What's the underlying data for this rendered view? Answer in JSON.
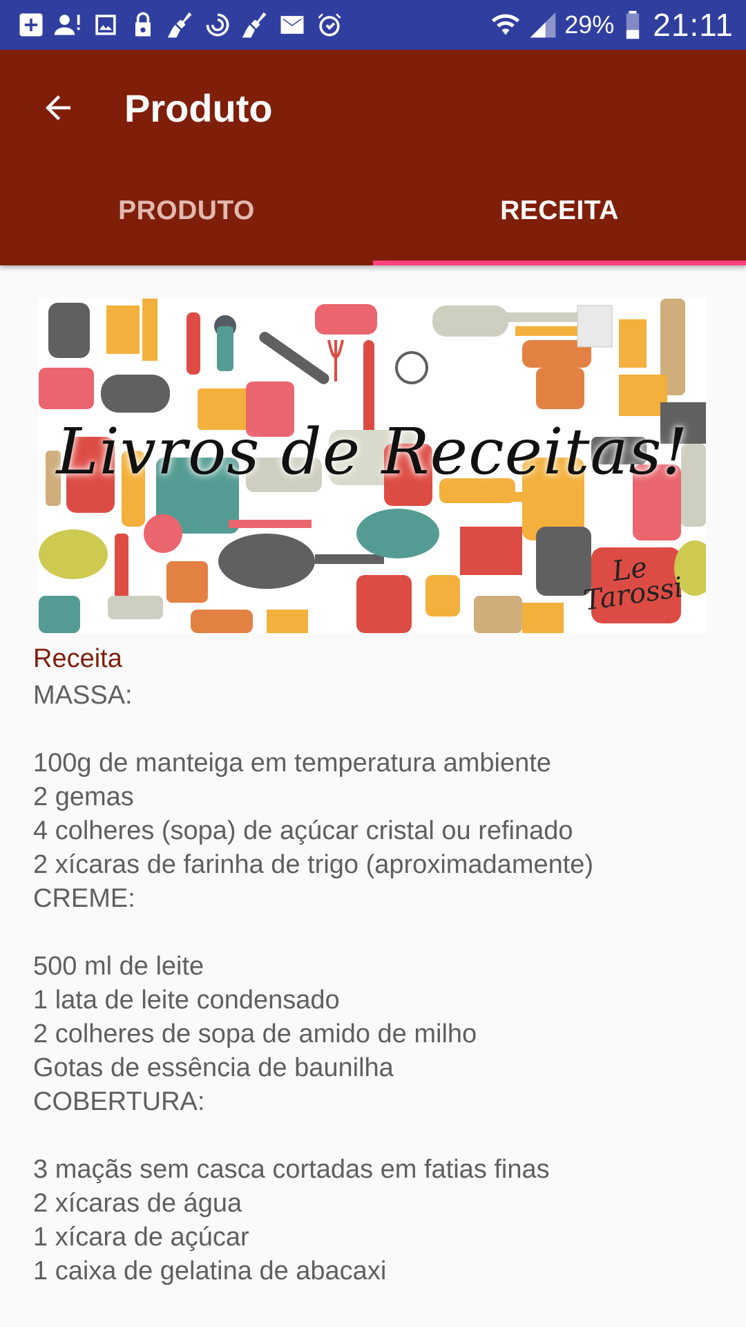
{
  "status_bar": {
    "icons": [
      "add-box-icon",
      "person-alert-icon",
      "image-icon",
      "lock-icon",
      "broom-icon",
      "sync-icon",
      "broom-icon",
      "mail-icon",
      "alarm-icon",
      "wifi-icon",
      "signal-icon",
      "battery-icon"
    ],
    "battery_percent": "29%",
    "time": "21:11",
    "color": "#303F9F"
  },
  "app_bar": {
    "title": "Produto",
    "back_icon": "arrow-back-icon",
    "color": "#7F1F0A"
  },
  "tabs": [
    {
      "label": "PRODUTO",
      "selected": false
    },
    {
      "label": "RECEITA",
      "selected": true
    }
  ],
  "tab_indicator_color": "#FF4081",
  "banner": {
    "title": "Livros de Receitas!",
    "signature_line1": "Le",
    "signature_line2": "Tarossi"
  },
  "recipe": {
    "label": "Receita",
    "lines": [
      "MASSA:",
      "",
      "100g de manteiga em temperatura ambiente",
      "2 gemas",
      "4 colheres (sopa) de açúcar cristal ou refinado",
      "2 xícaras de farinha de trigo (aproximadamente)",
      "CREME:",
      "",
      "500 ml de leite",
      "1 lata de leite condensado",
      "2 colheres de sopa de amido de milho",
      "Gotas de essência de baunilha",
      "COBERTURA:",
      "",
      "3 maçãs sem casca cortadas em fatias finas",
      "2 xícaras de água",
      "1 xícara de açúcar",
      "1 caixa de gelatina de abacaxi"
    ]
  }
}
